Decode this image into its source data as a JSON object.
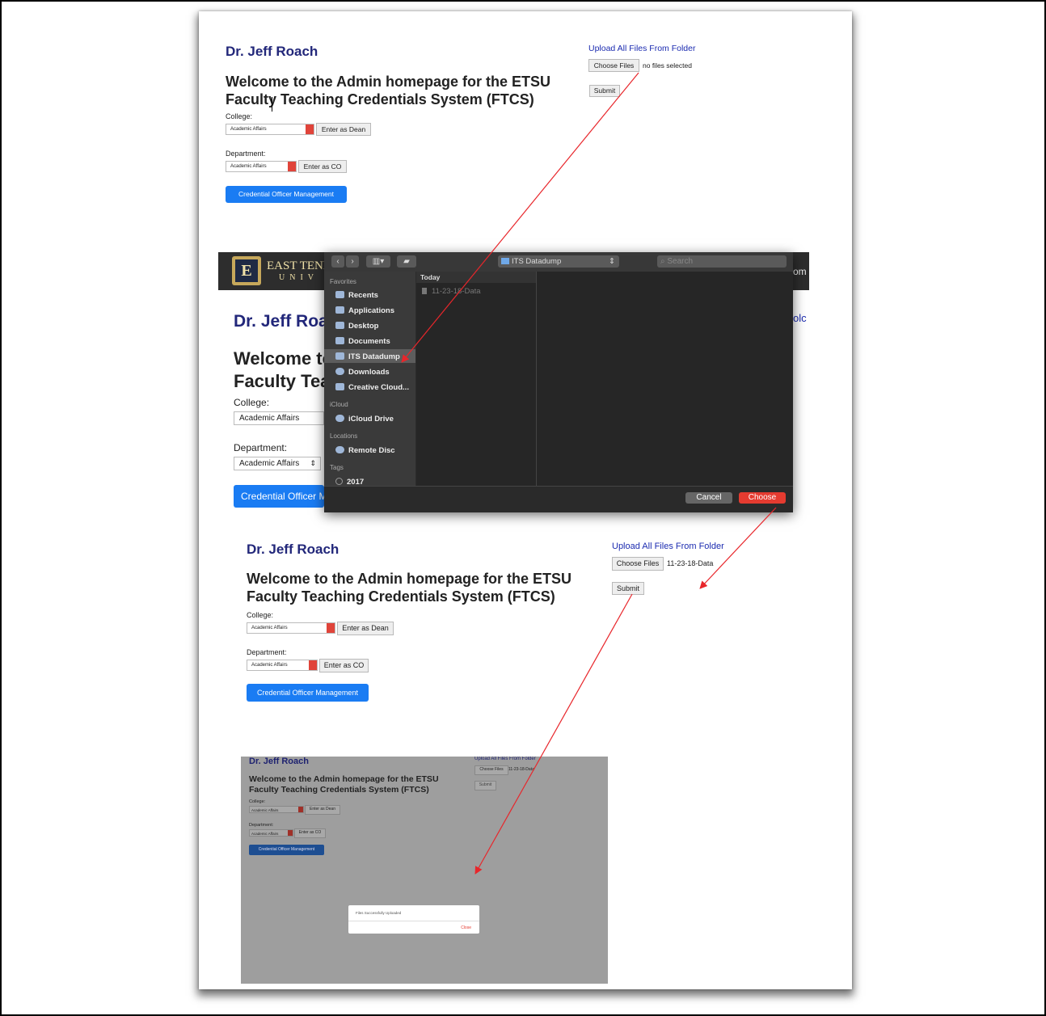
{
  "top": {
    "name": "Dr. Jeff Roach",
    "welcome_line1": "Welcome to the Admin homepage for the ETSU",
    "welcome_line2": "Faculty Teaching Credentials System (FTCS)",
    "college_label": "College:",
    "college_value": "Academic Affairs",
    "dean_button": "Enter as Dean",
    "department_label": "Department:",
    "department_value": "Academic Affairs",
    "co_button": "Enter as CO",
    "cred_button": "Credential Officer Management",
    "upload_link": "Upload All Files From Folder",
    "choose_files": "Choose Files",
    "files_status": "no files selected",
    "submit": "Submit"
  },
  "background_page": {
    "university_text_1": "EAST TENN",
    "university_text_2": "UNIV",
    "nav_fragment": "om",
    "upload_fragment": "olc",
    "name_fragment": "Dr. Jeff Roa",
    "welcome_fragment_1": "Welcome to",
    "welcome_fragment_2": "Faculty Tea",
    "college_label": "College:",
    "college_value": "Academic Affairs",
    "department_label": "Department:",
    "department_value": "Academic Affairs",
    "cred_fragment": "Credential Officer M"
  },
  "file_dialog": {
    "location": "ITS Datadump",
    "search_placeholder": "Search",
    "favorites_header": "Favorites",
    "favorites": [
      "Recents",
      "Applications",
      "Desktop",
      "Documents",
      "ITS Datadump",
      "Downloads",
      "Creative Cloud..."
    ],
    "icloud_header": "iCloud",
    "icloud_items": [
      "iCloud Drive"
    ],
    "locations_header": "Locations",
    "locations_items": [
      "Remote Disc"
    ],
    "tags_header": "Tags",
    "tags_items": [
      "2017"
    ],
    "column_header": "Today",
    "file_item": "11-23-18-Data",
    "cancel": "Cancel",
    "choose": "Choose"
  },
  "middle": {
    "name": "Dr. Jeff Roach",
    "welcome_line1": "Welcome to the Admin homepage for the ETSU",
    "welcome_line2": "Faculty Teaching Credentials System (FTCS)",
    "college_label": "College:",
    "college_value": "Academic Affairs",
    "dean_button": "Enter as Dean",
    "department_label": "Department:",
    "department_value": "Academic Affairs",
    "co_button": "Enter as CO",
    "cred_button": "Credential Officer Management",
    "upload_link": "Upload All Files From Folder",
    "choose_files": "Choose Files",
    "files_status": "11-23-18-Data",
    "submit": "Submit"
  },
  "bottom": {
    "name": "Dr. Jeff Roach",
    "welcome_line1": "Welcome to the Admin homepage for the ETSU",
    "welcome_line2": "Faculty Teaching Credentials System (FTCS)",
    "college_label": "College:",
    "college_value": "Academic Affairs",
    "dean_button": "Enter as Dean",
    "department_label": "Department:",
    "department_value": "Academic Affairs",
    "co_button": "Enter as CO",
    "cred_button": "Credential Officer Management",
    "upload_link": "Upload All Files From Folder",
    "choose_files": "Choose Files",
    "files_status": "11-23-18-Data",
    "submit": "Submit",
    "modal_message": "Files Successfully Uploaded",
    "modal_close": "Close"
  },
  "colors": {
    "arrow": "#e8262b",
    "primary": "#1a7cf3",
    "choose": "#e53b30"
  }
}
